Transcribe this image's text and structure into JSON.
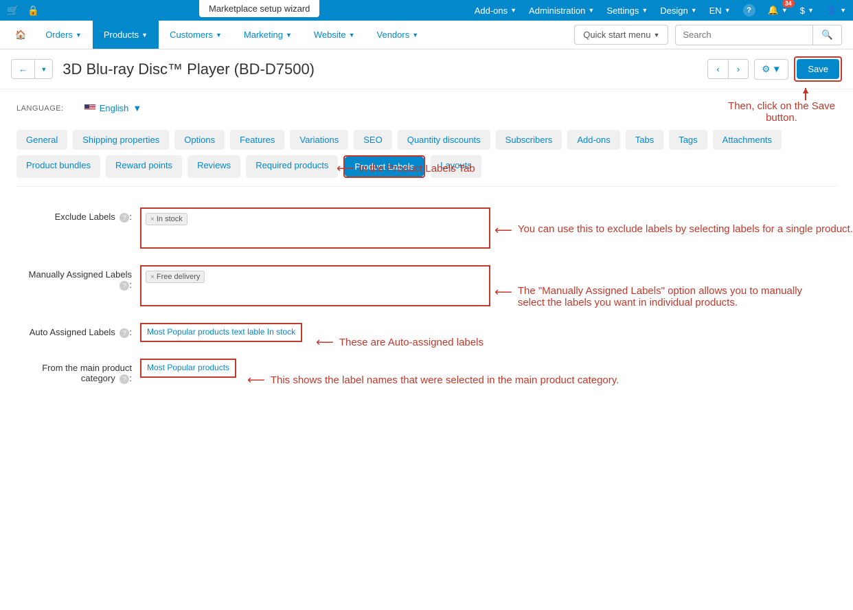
{
  "topbar": {
    "wizard": "Marketplace setup wizard",
    "menus": {
      "addons": "Add-ons",
      "administration": "Administration",
      "settings": "Settings",
      "design": "Design",
      "lang": "EN",
      "currency": "$"
    },
    "notif_count": "34"
  },
  "mainnav": {
    "orders": "Orders",
    "products": "Products",
    "customers": "Customers",
    "marketing": "Marketing",
    "website": "Website",
    "vendors": "Vendors",
    "quickstart": "Quick start menu",
    "search_placeholder": "Search"
  },
  "page": {
    "title": "3D Blu-ray Disc™ Player (BD-D7500)",
    "save": "Save"
  },
  "language": {
    "label": "LANGUAGE:",
    "value": "English"
  },
  "tabs": {
    "general": "General",
    "shipping": "Shipping properties",
    "options": "Options",
    "features": "Features",
    "variations": "Variations",
    "seo": "SEO",
    "qty": "Quantity discounts",
    "subscribers": "Subscribers",
    "addons": "Add-ons",
    "tabs": "Tabs",
    "tags": "Tags",
    "attachments": "Attachments",
    "bundles": "Product bundles",
    "reward": "Reward points",
    "reviews": "Reviews",
    "required": "Required products",
    "product_labels": "Product Labels",
    "layouts": "Layouts"
  },
  "form": {
    "exclude_label": "Exclude Labels",
    "exclude_tag": "In stock",
    "manual_label": "Manually Assigned Labels",
    "manual_tag": "Free delivery",
    "auto_label": "Auto Assigned Labels",
    "auto_value": "Most Popular products text lable In stock",
    "category_label": "From the main product category",
    "category_value": "Most Popular products"
  },
  "annotations": {
    "tab": "In the Product Labels Tab",
    "exclude": "You can use this to exclude labels by selecting labels for a single product.",
    "manual": "The \"Manually Assigned Labels\" option allows you to manually select the labels you want in individual products.",
    "auto": "These are Auto-assigned labels",
    "category": "This shows the label names that were selected in the main product category.",
    "save": "Then, click on the Save button."
  }
}
